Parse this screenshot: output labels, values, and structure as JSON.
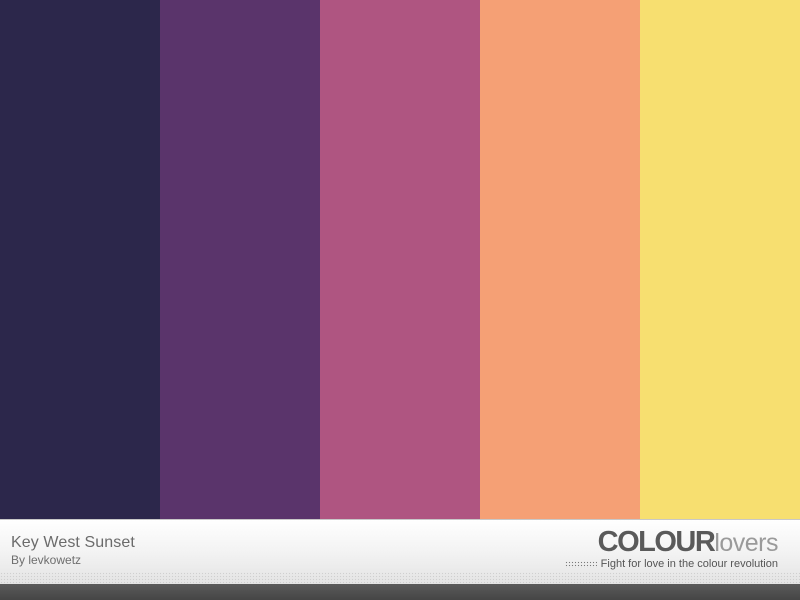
{
  "palette": {
    "title": "Key West Sunset",
    "author": "By levkowetz",
    "colors": [
      "#2c274b",
      "#5a346b",
      "#af5581",
      "#f5a075",
      "#f7df70"
    ]
  },
  "brand": {
    "name_strong": "COLOUR",
    "name_light": "lovers",
    "tagline": "Fight for love in the colour revolution"
  }
}
